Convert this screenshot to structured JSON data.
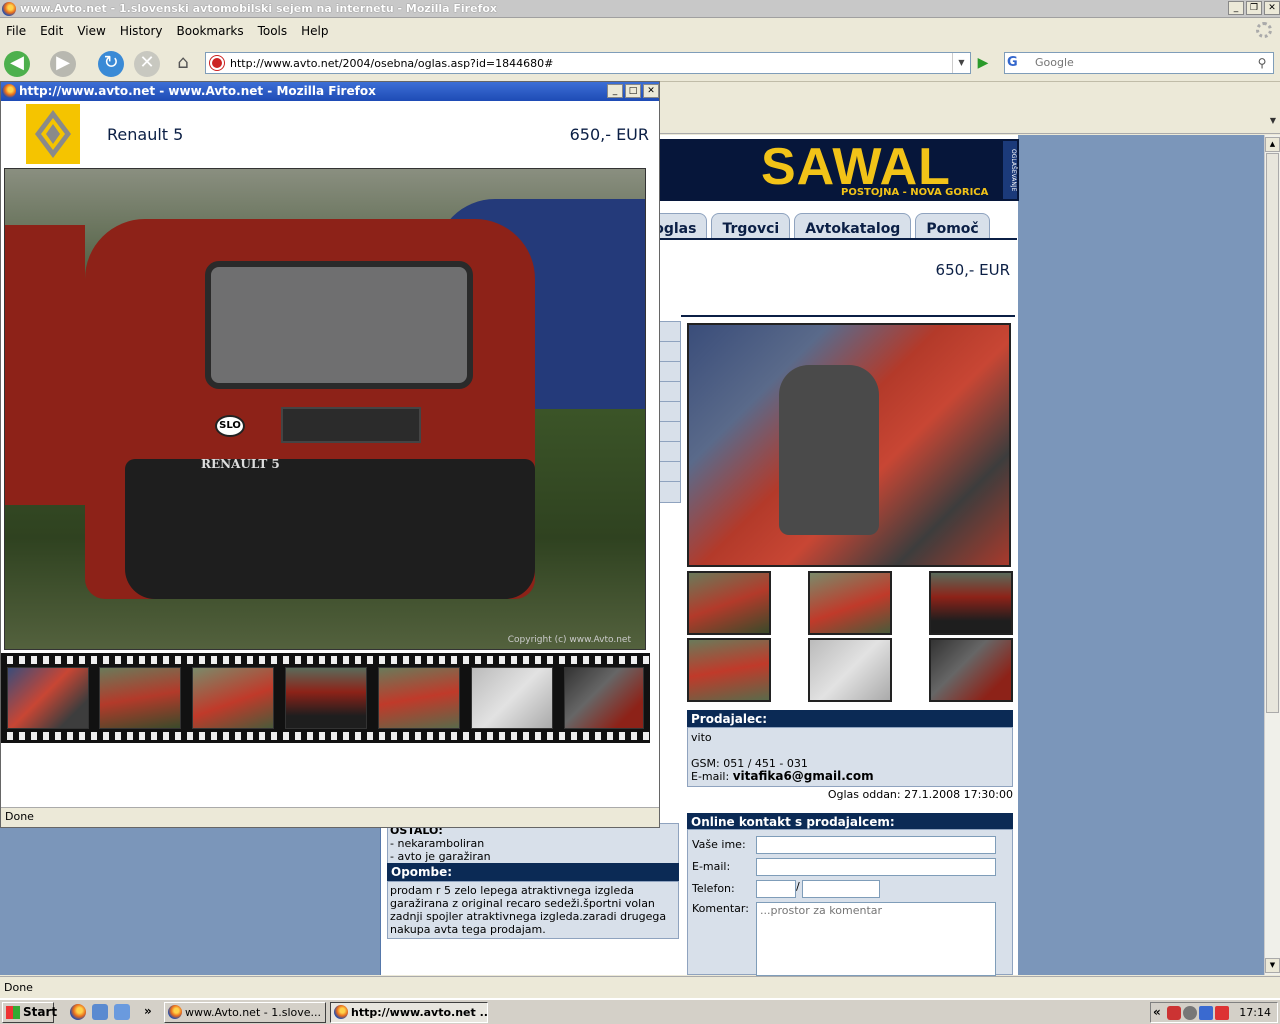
{
  "main_window": {
    "title": "www.Avto.net - 1.slovenski avtomobilski sejem na internetu - Mozilla Firefox",
    "controls": [
      "_",
      "❐",
      "✕"
    ]
  },
  "menu": [
    "File",
    "Edit",
    "View",
    "History",
    "Bookmarks",
    "Tools",
    "Help"
  ],
  "navbar": {
    "url": "http://www.avto.net/2004/osebna/oglas.asp?id=1844680#",
    "search_placeholder": "Google",
    "search_engine": "G"
  },
  "popup": {
    "title": "http://www.avto.net - www.Avto.net - Mozilla Firefox",
    "model": "Renault 5",
    "price": "650,- EUR",
    "photo_badge": "RENAULT 5",
    "photo_plate_sticker": "SLO",
    "photo_copyright": "Copyright (c) www.Avto.net",
    "status": "Done",
    "controls": [
      "_",
      "□",
      "✕"
    ]
  },
  "page": {
    "banner_title": "SAWAL",
    "banner_subtitle": "POSTOJNA - NOVA GORICA",
    "banner_vertical": "OGLAŠEVANJE",
    "tabs": [
      "š oglas",
      "Trgovci",
      "Avtokatalog",
      "Pomoč"
    ],
    "price": "650,- EUR",
    "seller": {
      "heading": "Prodajalec:",
      "name": "vito",
      "gsm": "GSM: 051 / 451 - 031",
      "email_label": "E-mail:",
      "email": "vitafika6@gmail.com"
    },
    "posted": "Oglas oddan: 27.1.2008 17:30:00",
    "contact": {
      "heading": "Online kontakt s prodajalcem:",
      "name_label": "Vaše ime:",
      "email_label": "E-mail:",
      "phone_label": "Telefon:",
      "comment_label": "Komentar:",
      "comment_placeholder": "...prostor za komentar"
    },
    "other": {
      "heading": "OSTALO:",
      "items": [
        "- nekaramboliran",
        "- avto je garažiran"
      ]
    },
    "notes": {
      "heading": "Opombe:",
      "lines": [
        "prodam r 5 zelo lepega atraktivnega izgleda",
        "garažirana z original recaro sedeži.športni volan",
        "zadnji spojler atraktivnega izgleda.zaradi drugega",
        "nakupa avta tega prodajam."
      ]
    }
  },
  "status": "Done",
  "taskbar": {
    "start": "Start",
    "more": "»",
    "tasks": [
      "www.Avto.net - 1.slove...",
      "http://www.avto.net ..."
    ],
    "tray_expand": "«",
    "clock": "17:14"
  },
  "colors": {
    "navy": "#0b1f45",
    "banner_yellow": "#f2c318",
    "page_bg": "#7b96ba",
    "renault_yellow": "#f5c400"
  }
}
